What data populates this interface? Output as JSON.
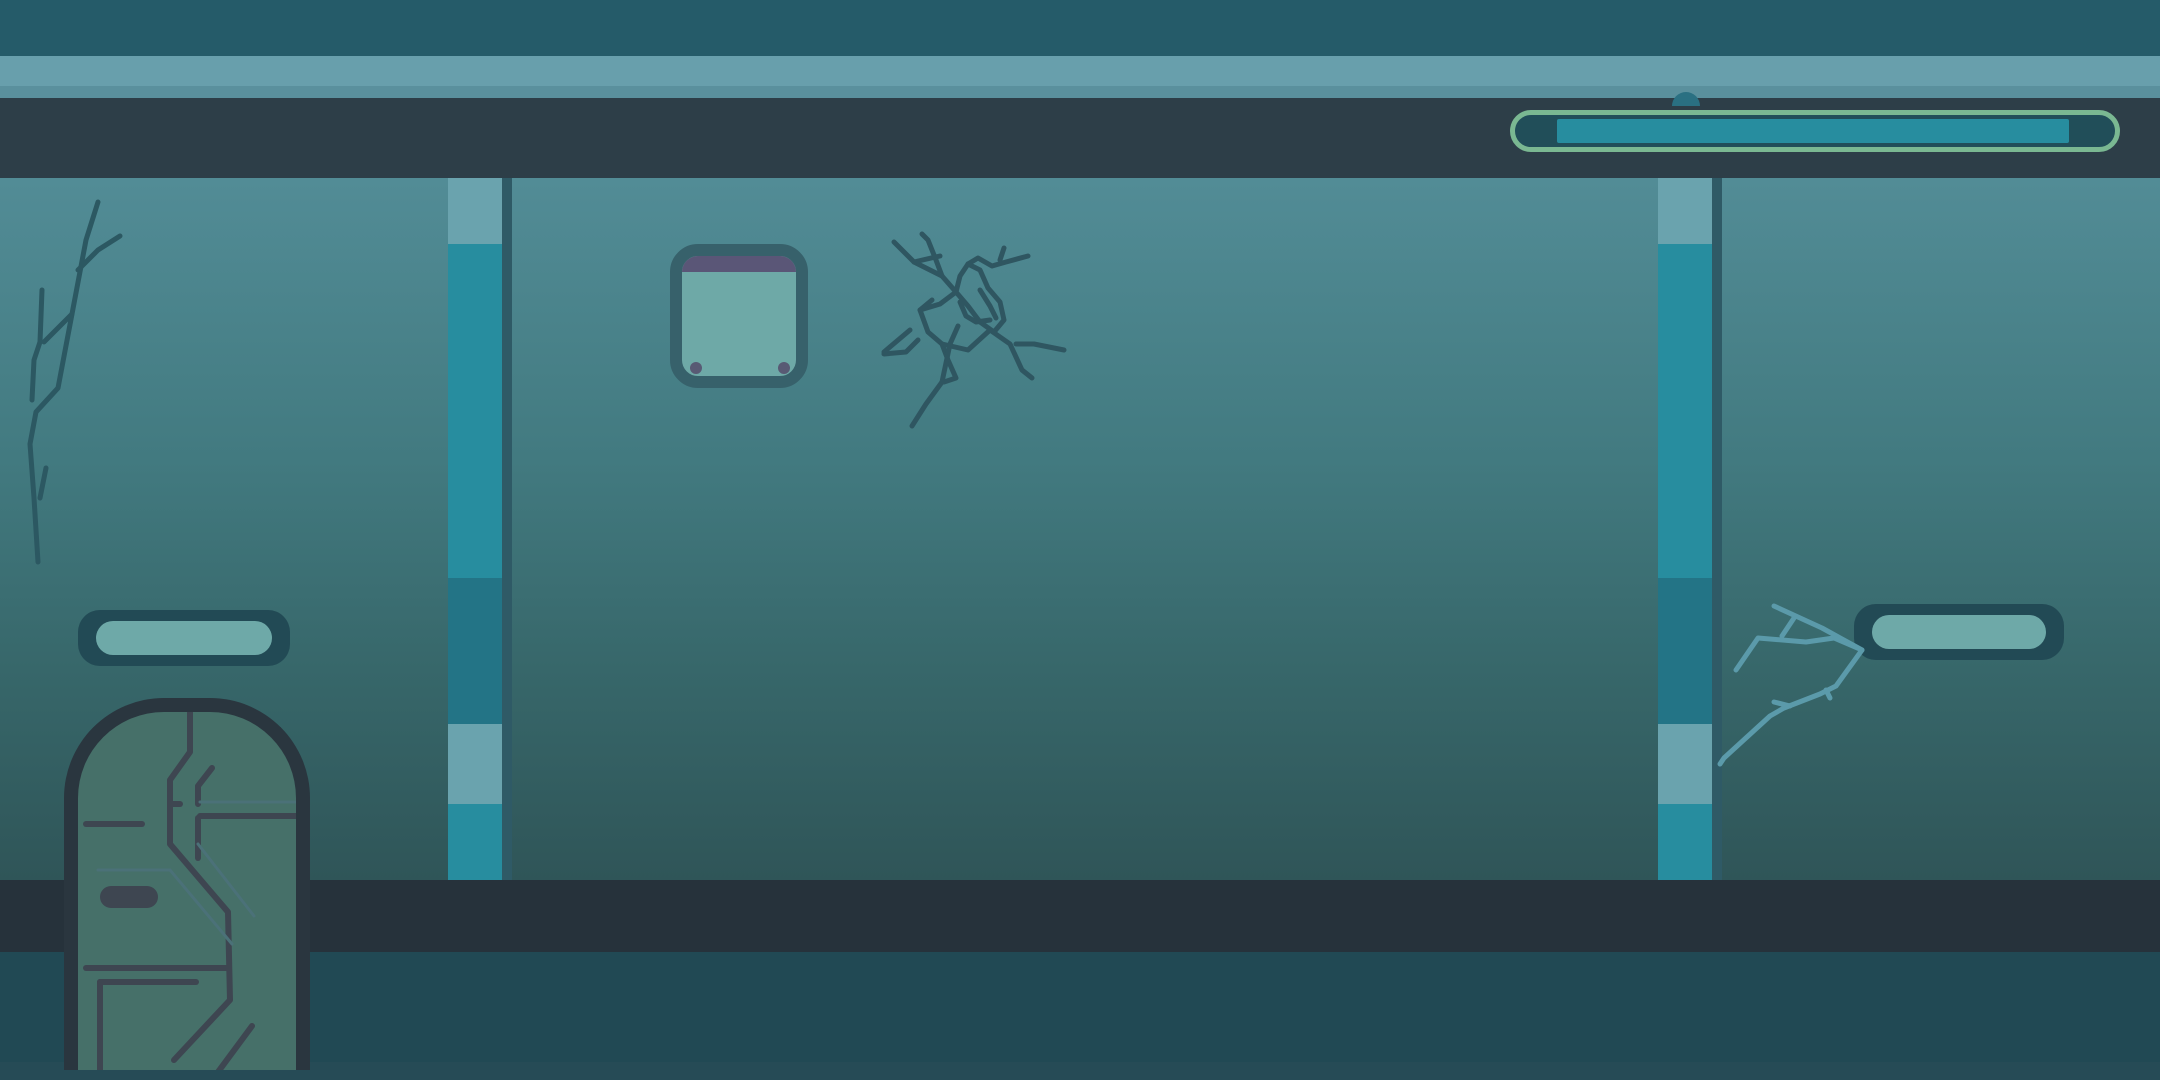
{
  "game": {
    "scene": "subway-platform",
    "player": {
      "health": 0.87
    },
    "colors": {
      "ceiling": "#2d3e48",
      "floor": "#26323b",
      "wall_top": "#528c96",
      "wall_bottom": "#2f5558",
      "pillar": "#278d9f",
      "health_border": "#7ab892",
      "health_fill": "#278d9f",
      "ledge": "#6ea9a8",
      "door": "#467069"
    },
    "icons": [
      "crack-icon",
      "door-icon",
      "wall-panel-icon"
    ]
  }
}
